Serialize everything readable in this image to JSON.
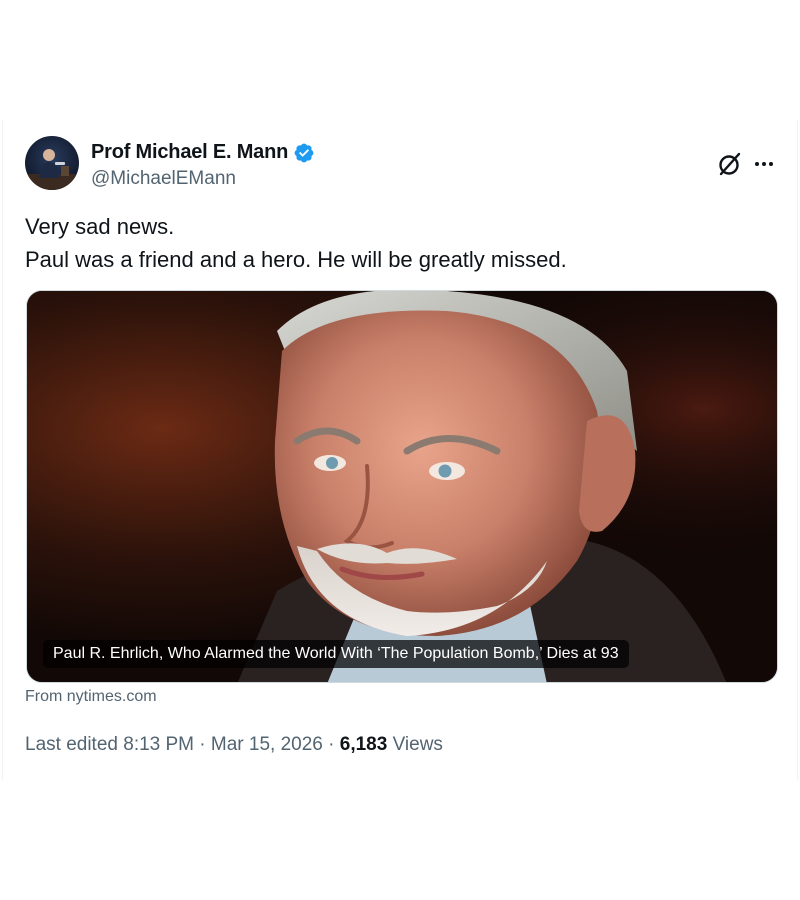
{
  "author": {
    "display_name": "Prof Michael E. Mann",
    "handle": "@MichaelEMann",
    "verified_icon": "verified-badge-icon",
    "badge_color": "#1d9bf0"
  },
  "actions": {
    "grok_icon": "grok-icon",
    "more_icon": "more-horizontal-icon"
  },
  "tweet": {
    "lines": [
      "Very sad news.",
      "Paul was a friend and a hero. He will be greatly missed."
    ]
  },
  "card": {
    "headline": "Paul R. Ehrlich, Who Alarmed the World With ‘The Population Bomb,’ Dies at 93",
    "source": "From nytimes.com"
  },
  "meta": {
    "edited_prefix": "Last edited",
    "time": "8:13 PM",
    "separator": "·",
    "date": "Mar 15, 2026",
    "views_count": "6,183",
    "views_label": "Views"
  },
  "colors": {
    "text_primary": "#0f1419",
    "text_secondary": "#536471",
    "border": "#cfd9de"
  }
}
